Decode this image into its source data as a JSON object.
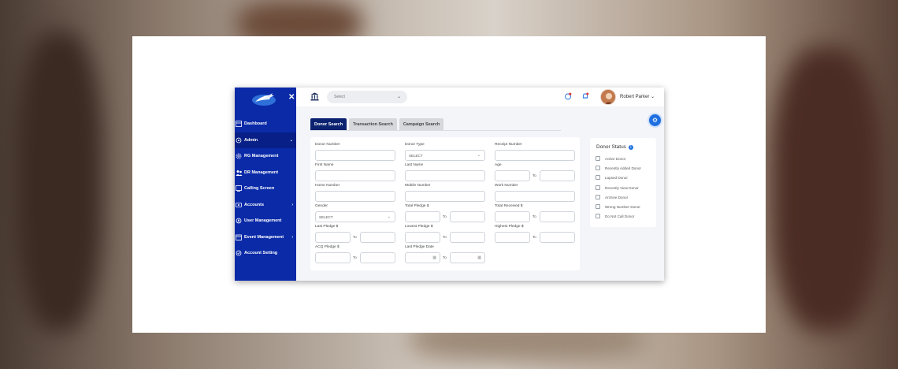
{
  "sidebar": {
    "items": [
      {
        "label": "Dashboard",
        "icon": "dashboard-icon",
        "active": false,
        "caret": ""
      },
      {
        "label": "Admin",
        "icon": "admin-gear-icon",
        "active": true,
        "caret": "⌄"
      },
      {
        "label": "RG Management",
        "icon": "gear-icon",
        "active": false,
        "caret": ""
      },
      {
        "label": "DR Management",
        "icon": "people-icon",
        "active": false,
        "caret": ""
      },
      {
        "label": "Calling Screen",
        "icon": "phone-screen-icon",
        "active": false,
        "caret": ""
      },
      {
        "label": "Accounts",
        "icon": "accounts-icon",
        "active": false,
        "caret": "›"
      },
      {
        "label": "User Management",
        "icon": "user-gear-icon",
        "active": false,
        "caret": ""
      },
      {
        "label": "Event Management",
        "icon": "calendar-icon",
        "active": false,
        "caret": "›"
      },
      {
        "label": "Account Setting",
        "icon": "account-setting-icon",
        "active": false,
        "caret": ""
      }
    ]
  },
  "topbar": {
    "select_placeholder": "Select",
    "user_name": "Robert Parker"
  },
  "tabs": [
    {
      "label": "Donor Search",
      "active": true
    },
    {
      "label": "Transaction Search",
      "active": false
    },
    {
      "label": "Campaign Search",
      "active": false
    }
  ],
  "form": {
    "donor_number": "Donor Number",
    "donor_type": "Donor Type",
    "donor_type_value": "SELECT",
    "receipt_number": "Receipt Number",
    "first_name": "First Name",
    "last_name": "Last Name",
    "age": "Age",
    "home_number": "Home Number",
    "mobile_number": "Mobile Number",
    "work_number": "Work Number",
    "gender": "Gender",
    "gender_value": "SELECT",
    "total_pledge": "Total Pledge $",
    "total_received": "Total Received $",
    "last_pledge": "Last Pledge $",
    "lowest_pledge": "Lowest Pledge $",
    "highest_pledge": "Highest Pledge $",
    "acq_pledge": "ACQ Pledge $",
    "last_pledge_date": "Last Pledge Date",
    "to_label": "To"
  },
  "donor_status": {
    "title": "Donor Status",
    "items": [
      "Active Donor",
      "Recently Added Donor",
      "Lapsed Donor",
      "Recently View Donor",
      "Archive Donor",
      "Wrong Number Donor",
      "Do Not Call Donor"
    ]
  },
  "colors": {
    "sidebar": "#0a2aa8",
    "active_tab": "#0a2270",
    "accent": "#1e6fe0"
  }
}
